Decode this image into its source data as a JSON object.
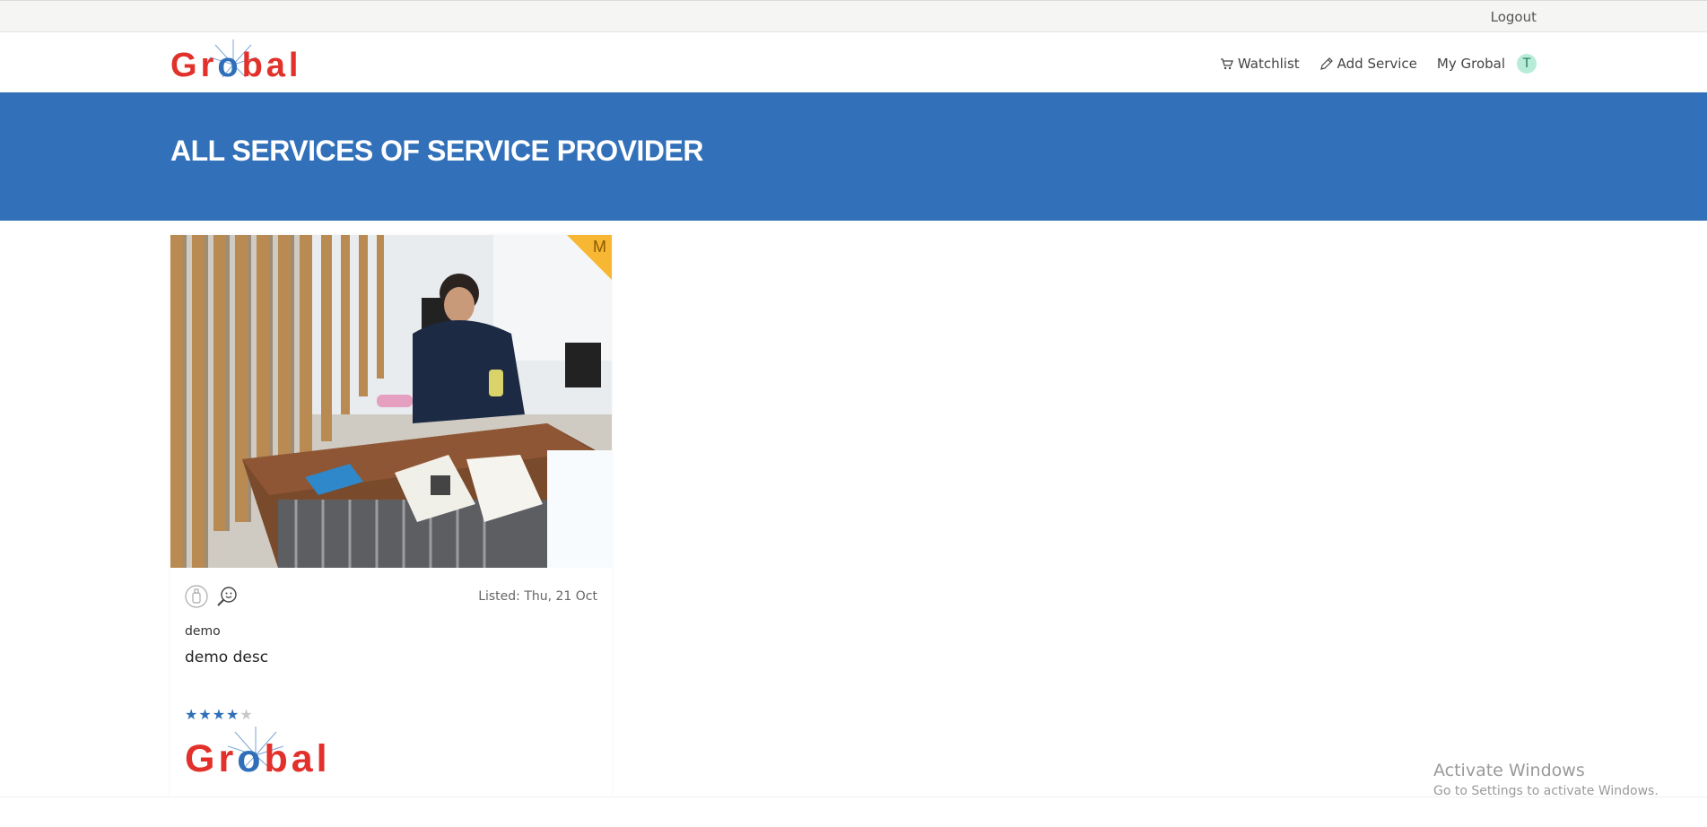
{
  "topbar": {
    "logout_label": "Logout"
  },
  "brand": {
    "logo_text": "Grobal",
    "logo_colors": {
      "red": "#e1312a",
      "blue": "#2f6fb9"
    }
  },
  "nav": {
    "watchlist_label": "Watchlist",
    "add_service_label": "Add Service",
    "my_account_label": "My Grobal",
    "avatar_initial": "T"
  },
  "hero": {
    "title": "ALL SERVICES OF SERVICE PROVIDER",
    "background": "#3271b9"
  },
  "service_card": {
    "badge_letter": "M",
    "badge_color": "#f7b733",
    "image_description_icon": "photo",
    "listed_text": "Listed: Thu, 21 Oct",
    "name": "demo",
    "description": "demo desc",
    "rating": 4,
    "rating_max": 5,
    "provider_logo_text": "Grobal",
    "icons": [
      "hand-sanitizer-icon",
      "search-face-icon"
    ]
  },
  "os_watermark": {
    "line1": "Activate Windows",
    "line2": "Go to Settings to activate Windows."
  }
}
